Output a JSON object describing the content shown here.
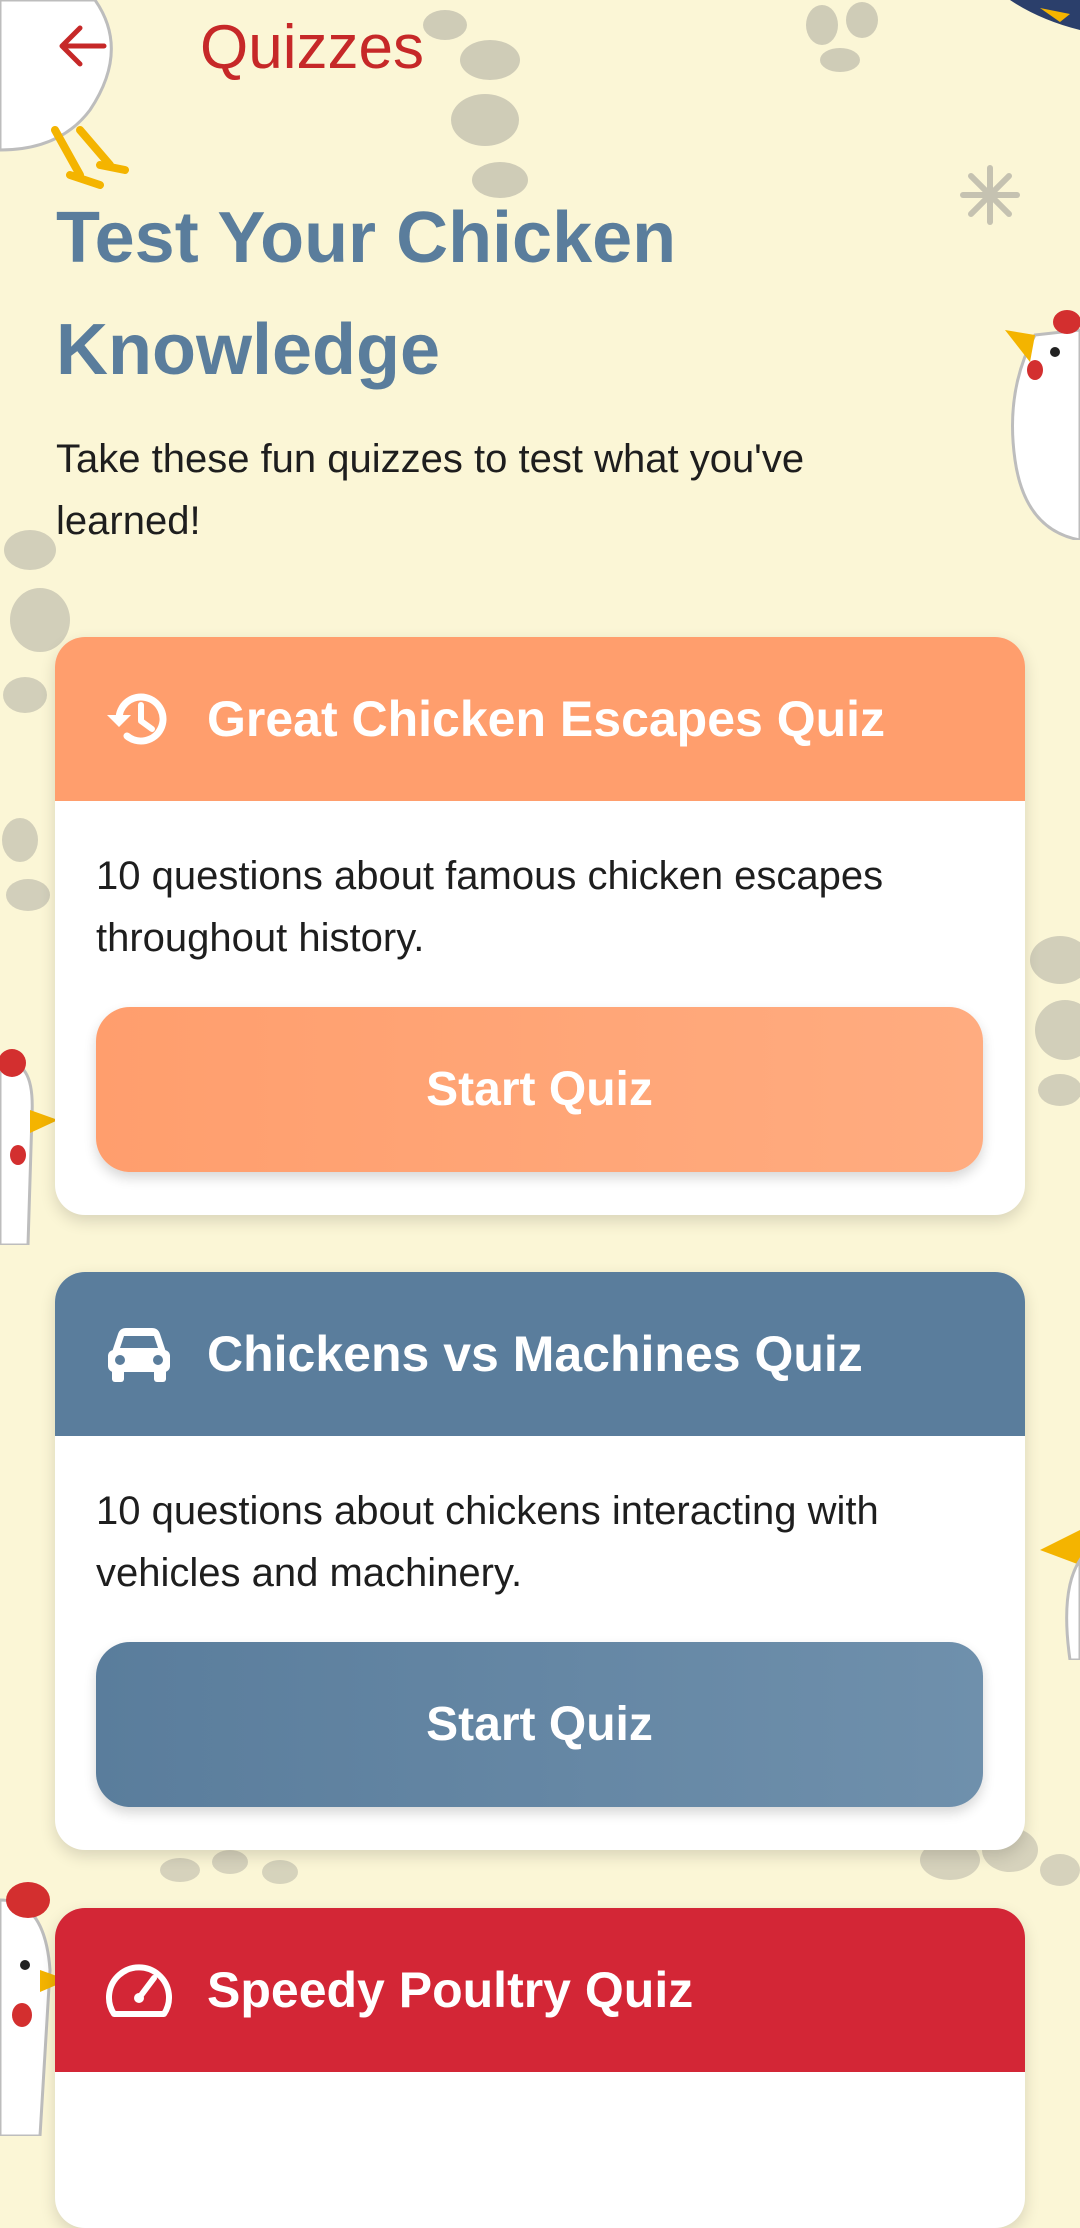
{
  "appbar": {
    "title": "Quizzes",
    "back_icon": "arrow-left-icon"
  },
  "page": {
    "title": "Test Your Chicken Knowledge",
    "subtitle": "Take these fun quizzes to test what you've learned!"
  },
  "quizzes": [
    {
      "title": "Great Chicken Escapes Quiz",
      "description": "10 questions about famous chicken escapes throughout history.",
      "button_label": "Start Quiz",
      "icon": "history-icon",
      "color": "#ff9e6d"
    },
    {
      "title": "Chickens vs Machines Quiz",
      "description": "10 questions about chickens interacting with vehicles and machinery.",
      "button_label": "Start Quiz",
      "icon": "car-icon",
      "color": "#5a7d9c"
    },
    {
      "title": "Speedy Poultry Quiz",
      "icon": "speedometer-icon",
      "color": "#d32636"
    }
  ],
  "colors": {
    "background": "#fbf6d6",
    "accent_red": "#c62828",
    "title_blue": "#5a7d9c"
  }
}
